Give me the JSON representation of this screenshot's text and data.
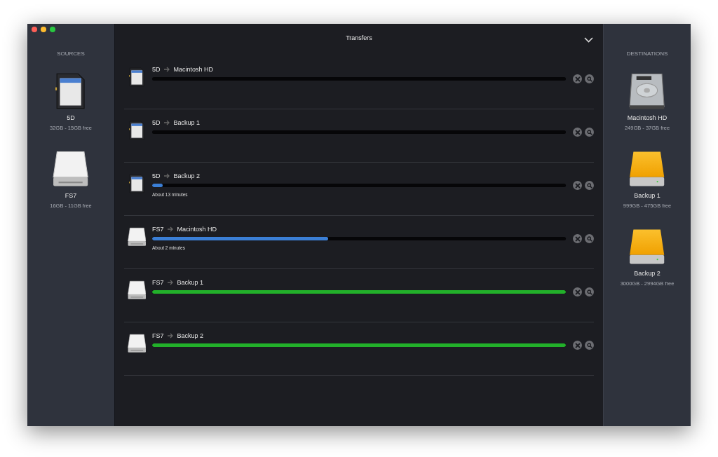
{
  "window": {
    "title": "Transfers"
  },
  "sources": {
    "heading": "SOURCES",
    "items": [
      {
        "kind": "sd-card",
        "name": "5D",
        "capacity": "32GB - 15GB free"
      },
      {
        "kind": "drive",
        "name": "FS7",
        "capacity": "16GB - 11GB free"
      }
    ]
  },
  "transfers": [
    {
      "kind": "queued",
      "source": {
        "kind": "sd-card",
        "name": "5D"
      },
      "destination": "Macintosh HD",
      "level": 0
    },
    {
      "kind": "queued",
      "source": {
        "kind": "sd-card",
        "name": "5D"
      },
      "destination": "Backup 1",
      "level": 0
    },
    {
      "kind": "copying",
      "source": {
        "kind": "sd-card",
        "name": "5D"
      },
      "destination": "Backup 2",
      "level": 0.025,
      "remaining": "About 13 minutes"
    },
    {
      "kind": "copying",
      "source": {
        "kind": "drive",
        "name": "FS7"
      },
      "destination": "Macintosh HD",
      "level": 0.425,
      "remaining": "About 2 minutes"
    },
    {
      "kind": "done",
      "source": {
        "kind": "drive",
        "name": "FS7"
      },
      "destination": "Backup 1",
      "level": 1
    },
    {
      "kind": "done",
      "source": {
        "kind": "drive",
        "name": "FS7"
      },
      "destination": "Backup 2",
      "level": 1
    }
  ],
  "destinations": {
    "heading": "DESTINATIONS",
    "items": [
      {
        "kind": "hard-disk",
        "name": "Macintosh HD",
        "capacity": "249GB - 37GB free"
      },
      {
        "kind": "external-drive",
        "name": "Backup 1",
        "capacity": "999GB - 475GB free"
      },
      {
        "kind": "external-drive",
        "name": "Backup 2",
        "capacity": "3000GB - 2994GB free"
      }
    ]
  }
}
